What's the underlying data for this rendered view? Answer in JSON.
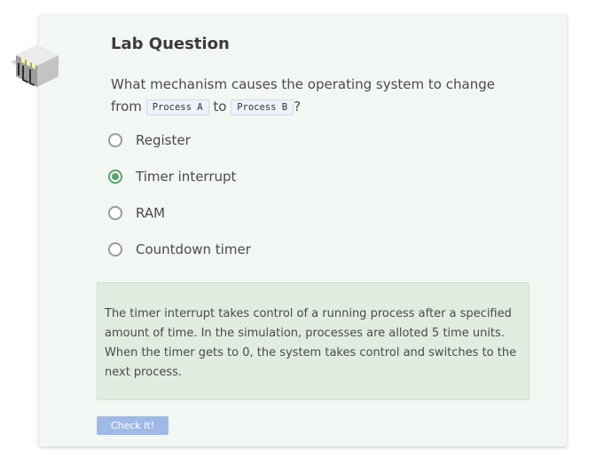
{
  "lab": {
    "title": "Lab Question",
    "question_before": "What mechanism causes the operating system to change from ",
    "code_a": "Process A",
    "question_middle": " to ",
    "code_b": "Process B",
    "question_after": "?"
  },
  "options": [
    {
      "label": "Register",
      "selected": false
    },
    {
      "label": "Timer interrupt",
      "selected": true
    },
    {
      "label": "RAM",
      "selected": false
    },
    {
      "label": "Countdown timer",
      "selected": false
    }
  ],
  "feedback": {
    "text": "The timer interrupt takes control of a running process after a specified amount of time. In the simulation, processes are alloted 5 time units. When the timer gets to 0, the system takes control and switches to the next process."
  },
  "check_button": {
    "label": "Check It!"
  },
  "icons": {
    "lab_icon": "server-rack-icon"
  },
  "colors": {
    "card_background": "#f3f7f3",
    "feedback_background": "#e1ece1",
    "selected_radio": "#5aa36a",
    "button_background": "#9fb9e6"
  }
}
